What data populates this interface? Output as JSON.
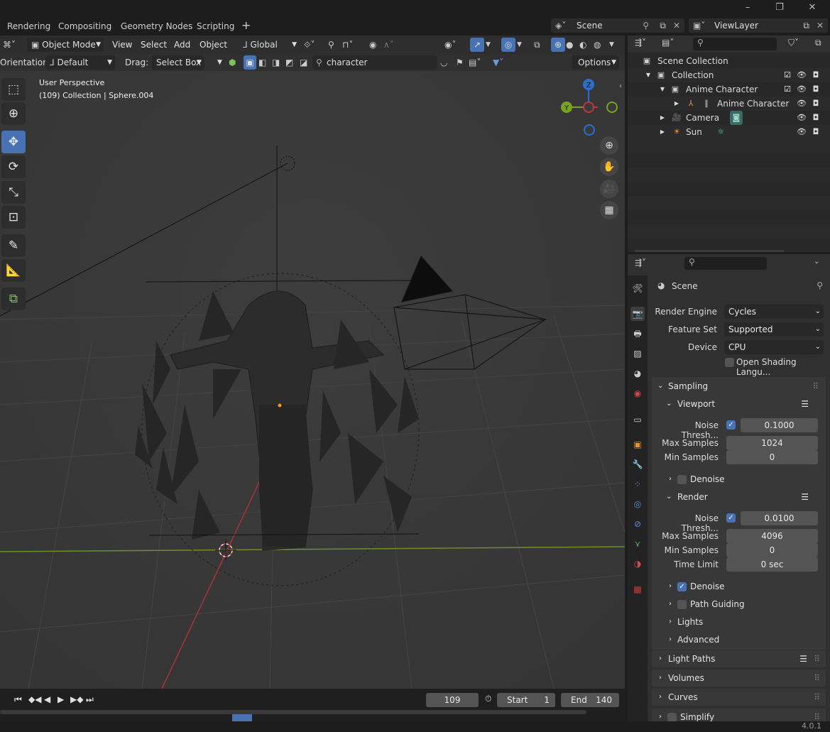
{
  "app": {
    "version": "4.0.1"
  },
  "workspace_tabs": [
    "Rendering",
    "Compositing",
    "Geometry Nodes",
    "Scripting"
  ],
  "scene_selector": {
    "value": "Scene"
  },
  "view_layer_selector": {
    "value": "ViewLayer"
  },
  "viewport_header": {
    "mode": "Object Mode",
    "menus": [
      "View",
      "Select",
      "Add",
      "Object"
    ],
    "transform_orientation": "Global"
  },
  "tool_settings": {
    "orientation_label": "Orientation:",
    "orientation_value": "Default",
    "drag_label": "Drag:",
    "drag_value": "Select Box",
    "filter_search": "character",
    "options_label": "Options"
  },
  "viewport_overlay": {
    "perspective": "User Perspective",
    "context": "(109) Collection | Sphere.004"
  },
  "gizmo": {
    "z_label": "Z",
    "y_label": "Y"
  },
  "tools": [
    "select-box",
    "cursor",
    "move",
    "rotate",
    "scale",
    "transform",
    "annotate",
    "measure",
    "add-cube"
  ],
  "timeline": {
    "current_frame": "109",
    "start_label": "Start",
    "start_value": "1",
    "end_label": "End",
    "end_value": "140"
  },
  "outliner": {
    "rows": [
      {
        "label": "Scene Collection",
        "icon": "scene-collection-icon"
      },
      {
        "label": "Collection",
        "icon": "collection-icon"
      },
      {
        "label": "Anime Character",
        "icon": "collection-icon"
      },
      {
        "label": "Anime Character",
        "icon": "armature-icon"
      },
      {
        "label": "Camera",
        "icon": "camera-icon"
      },
      {
        "label": "Sun",
        "icon": "light-icon"
      }
    ]
  },
  "properties": {
    "context": "Scene",
    "render_engine_label": "Render Engine",
    "render_engine": "Cycles",
    "feature_set_label": "Feature Set",
    "feature_set": "Supported",
    "device_label": "Device",
    "device": "CPU",
    "osl_label": "Open Shading Langu...",
    "sampling": {
      "title": "Sampling",
      "viewport": {
        "title": "Viewport",
        "noise_threshold_label": "Noise Thresh...",
        "noise_threshold": "0.1000",
        "max_samples_label": "Max Samples",
        "max_samples": "1024",
        "min_samples_label": "Min Samples",
        "min_samples": "0",
        "denoise_label": "Denoise"
      },
      "render": {
        "title": "Render",
        "noise_threshold_label": "Noise Thresh...",
        "noise_threshold": "0.0100",
        "max_samples_label": "Max Samples",
        "max_samples": "4096",
        "min_samples_label": "Min Samples",
        "min_samples": "0",
        "time_limit_label": "Time Limit",
        "time_limit": "0 sec",
        "denoise_label": "Denoise"
      },
      "path_guiding_label": "Path Guiding",
      "lights_label": "Lights",
      "advanced_label": "Advanced"
    },
    "panels": [
      "Light Paths",
      "Volumes",
      "Curves",
      "Simplify"
    ]
  },
  "colors": {
    "accent": "#4772b3",
    "x_axis": "#c8323c",
    "y_axis": "#7aa31f",
    "z_axis": "#2d6dd0"
  }
}
